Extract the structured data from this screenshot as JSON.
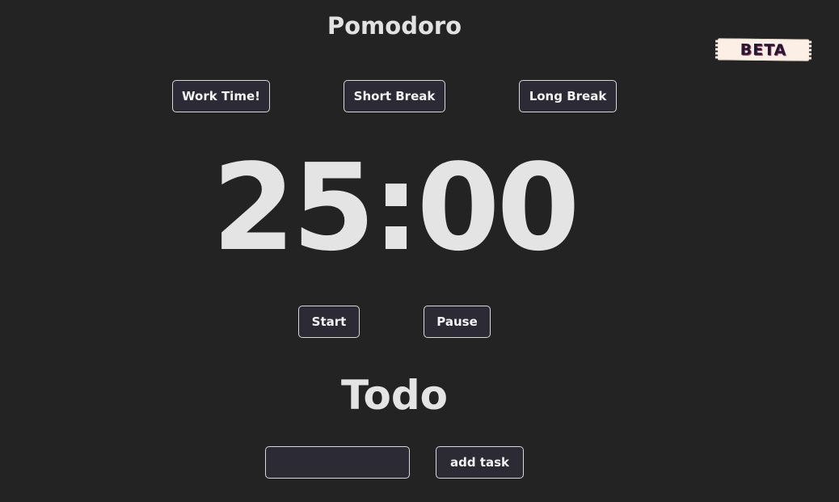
{
  "header": {
    "title": "Pomodoro",
    "badge": "BETA"
  },
  "modes": {
    "work_label": "Work Time!",
    "short_break_label": "Short Break",
    "long_break_label": "Long Break"
  },
  "timer": {
    "display": "25:00"
  },
  "controls": {
    "start_label": "Start",
    "pause_label": "Pause"
  },
  "todo": {
    "title": "Todo",
    "input_value": "",
    "input_placeholder": "",
    "add_label": "add task"
  },
  "colors": {
    "background": "#232323",
    "button_bg": "#2c2a35",
    "text": "#e4e4e4",
    "badge_bg": "#fbefe6"
  }
}
